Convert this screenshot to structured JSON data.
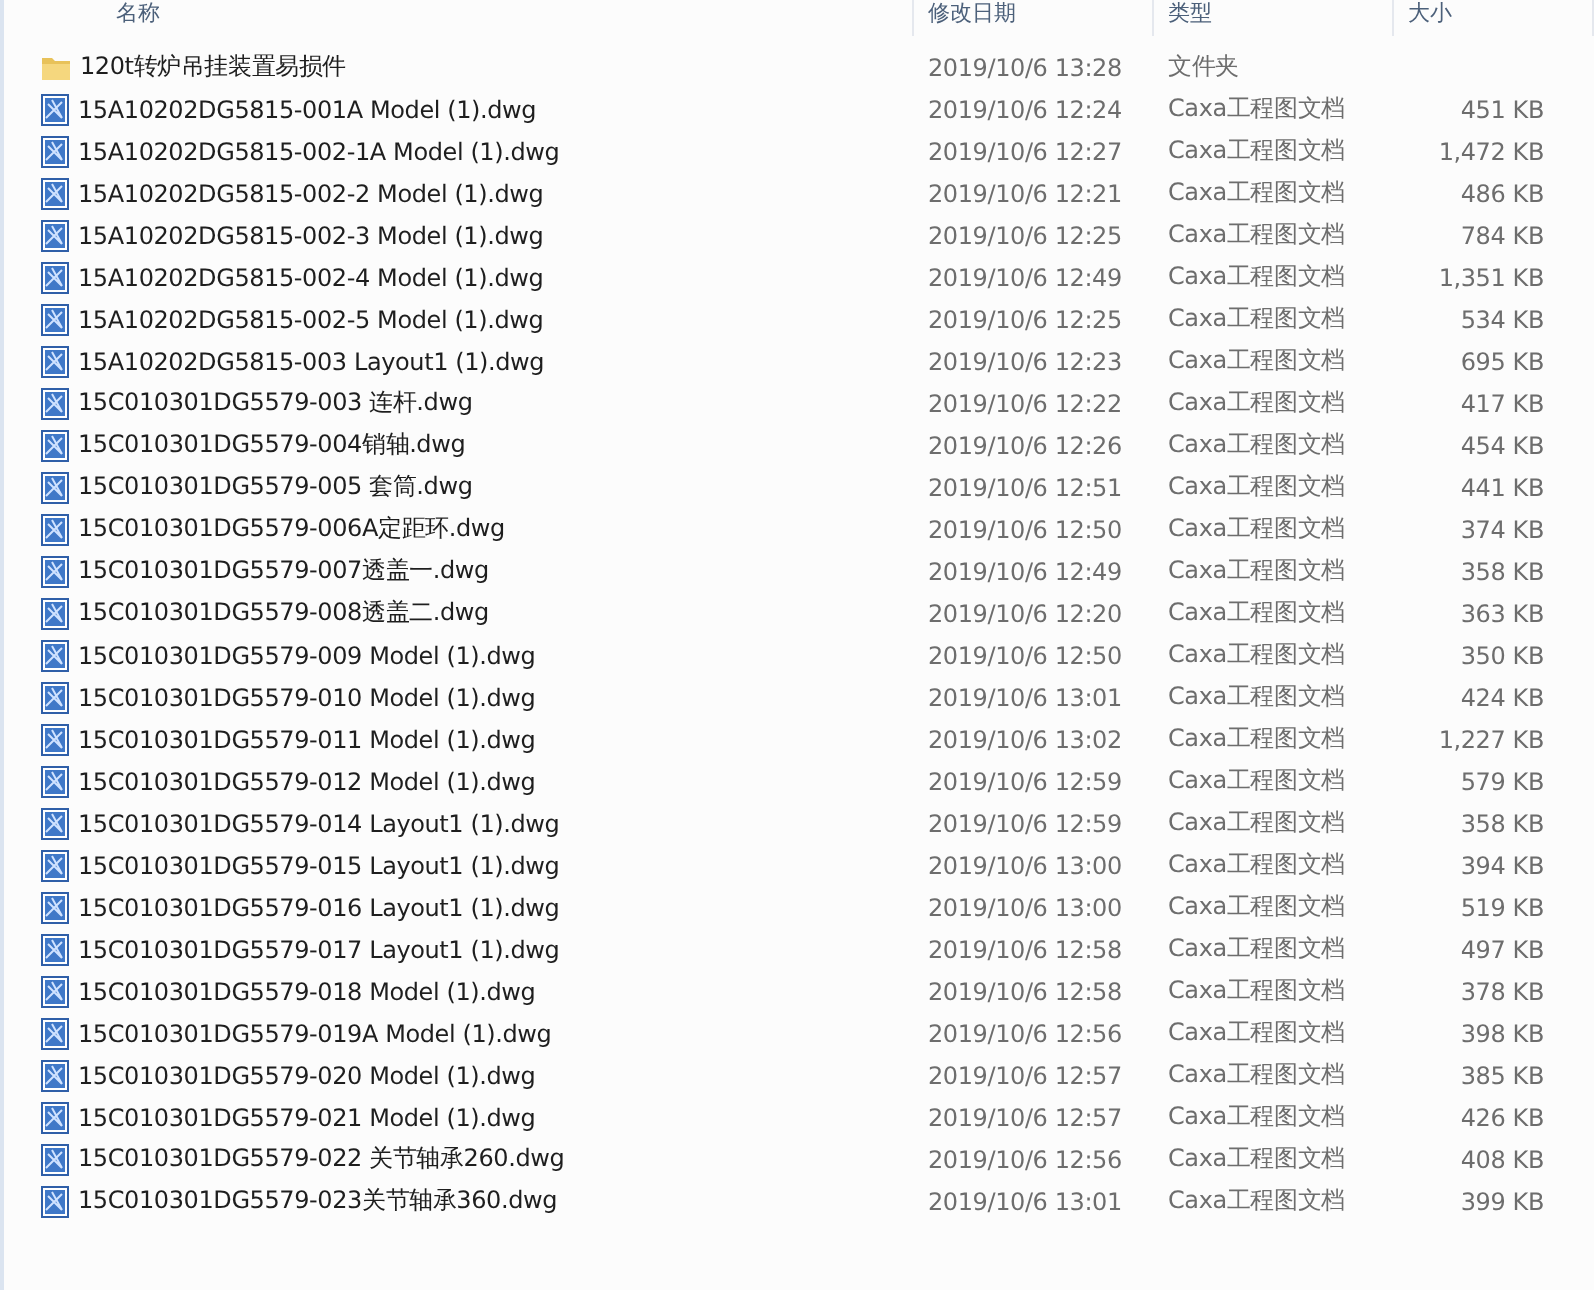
{
  "columns": [
    "名称",
    "修改日期",
    "类型",
    "大小"
  ],
  "rows": [
    {
      "kind": "folder",
      "name": "120t转炉吊挂装置易损件",
      "modified": "2019/10/6 13:28",
      "type": "文件夹"
    },
    {
      "kind": "file",
      "name": "15A10202DG5815-001A Model (1).dwg",
      "modified": "2019/10/6 12:24",
      "type": "Caxa工程图文档",
      "size": "451 KB"
    },
    {
      "kind": "file",
      "name": "15A10202DG5815-002-1A Model (1).dwg",
      "modified": "2019/10/6 12:27",
      "type": "Caxa工程图文档",
      "size": "1,472 KB"
    },
    {
      "kind": "file",
      "name": "15A10202DG5815-002-2 Model (1).dwg",
      "modified": "2019/10/6 12:21",
      "type": "Caxa工程图文档",
      "size": "486 KB"
    },
    {
      "kind": "file",
      "name": "15A10202DG5815-002-3 Model (1).dwg",
      "modified": "2019/10/6 12:25",
      "type": "Caxa工程图文档",
      "size": "784 KB"
    },
    {
      "kind": "file",
      "name": "15A10202DG5815-002-4 Model (1).dwg",
      "modified": "2019/10/6 12:49",
      "type": "Caxa工程图文档",
      "size": "1,351 KB"
    },
    {
      "kind": "file",
      "name": "15A10202DG5815-002-5 Model (1).dwg",
      "modified": "2019/10/6 12:25",
      "type": "Caxa工程图文档",
      "size": "534 KB"
    },
    {
      "kind": "file",
      "name": "15A10202DG5815-003 Layout1 (1).dwg",
      "modified": "2019/10/6 12:23",
      "type": "Caxa工程图文档",
      "size": "695 KB"
    },
    {
      "kind": "file",
      "name": "15C010301DG5579-003 连杆.dwg",
      "modified": "2019/10/6 12:22",
      "type": "Caxa工程图文档",
      "size": "417 KB"
    },
    {
      "kind": "file",
      "name": "15C010301DG5579-004销轴.dwg",
      "modified": "2019/10/6 12:26",
      "type": "Caxa工程图文档",
      "size": "454 KB"
    },
    {
      "kind": "file",
      "name": "15C010301DG5579-005 套筒.dwg",
      "modified": "2019/10/6 12:51",
      "type": "Caxa工程图文档",
      "size": "441 KB"
    },
    {
      "kind": "file",
      "name": "15C010301DG5579-006A定距环.dwg",
      "modified": "2019/10/6 12:50",
      "type": "Caxa工程图文档",
      "size": "374 KB"
    },
    {
      "kind": "file",
      "name": "15C010301DG5579-007透盖一.dwg",
      "modified": "2019/10/6 12:49",
      "type": "Caxa工程图文档",
      "size": "358 KB"
    },
    {
      "kind": "file",
      "name": "15C010301DG5579-008透盖二.dwg",
      "modified": "2019/10/6 12:20",
      "type": "Caxa工程图文档",
      "size": "363 KB"
    },
    {
      "kind": "file",
      "name": "15C010301DG5579-009 Model (1).dwg",
      "modified": "2019/10/6 12:50",
      "type": "Caxa工程图文档",
      "size": "350 KB"
    },
    {
      "kind": "file",
      "name": "15C010301DG5579-010 Model (1).dwg",
      "modified": "2019/10/6 13:01",
      "type": "Caxa工程图文档",
      "size": "424 KB"
    },
    {
      "kind": "file",
      "name": "15C010301DG5579-011 Model (1).dwg",
      "modified": "2019/10/6 13:02",
      "type": "Caxa工程图文档",
      "size": "1,227 KB"
    },
    {
      "kind": "file",
      "name": "15C010301DG5579-012 Model (1).dwg",
      "modified": "2019/10/6 12:59",
      "type": "Caxa工程图文档",
      "size": "579 KB"
    },
    {
      "kind": "file",
      "name": "15C010301DG5579-014 Layout1 (1).dwg",
      "modified": "2019/10/6 12:59",
      "type": "Caxa工程图文档",
      "size": "358 KB"
    },
    {
      "kind": "file",
      "name": "15C010301DG5579-015 Layout1 (1).dwg",
      "modified": "2019/10/6 13:00",
      "type": "Caxa工程图文档",
      "size": "394 KB"
    },
    {
      "kind": "file",
      "name": "15C010301DG5579-016 Layout1 (1).dwg",
      "modified": "2019/10/6 13:00",
      "type": "Caxa工程图文档",
      "size": "519 KB"
    },
    {
      "kind": "file",
      "name": "15C010301DG5579-017 Layout1 (1).dwg",
      "modified": "2019/10/6 12:58",
      "type": "Caxa工程图文档",
      "size": "497 KB"
    },
    {
      "kind": "file",
      "name": "15C010301DG5579-018 Model (1).dwg",
      "modified": "2019/10/6 12:58",
      "type": "Caxa工程图文档",
      "size": "378 KB"
    },
    {
      "kind": "file",
      "name": "15C010301DG5579-019A Model (1).dwg",
      "modified": "2019/10/6 12:56",
      "type": "Caxa工程图文档",
      "size": "398 KB"
    },
    {
      "kind": "file",
      "name": "15C010301DG5579-020 Model (1).dwg",
      "modified": "2019/10/6 12:57",
      "type": "Caxa工程图文档",
      "size": "385 KB"
    },
    {
      "kind": "file",
      "name": "15C010301DG5579-021 Model (1).dwg",
      "modified": "2019/10/6 12:57",
      "type": "Caxa工程图文档",
      "size": "426 KB"
    },
    {
      "kind": "file",
      "name": "15C010301DG5579-022 关节轴承260.dwg",
      "modified": "2019/10/6 12:56",
      "type": "Caxa工程图文档",
      "size": "408 KB"
    },
    {
      "kind": "file",
      "name": "15C010301DG5579-023关节轴承360.dwg",
      "modified": "2019/10/6 13:01",
      "type": "Caxa工程图文档",
      "size": "399 KB"
    }
  ]
}
